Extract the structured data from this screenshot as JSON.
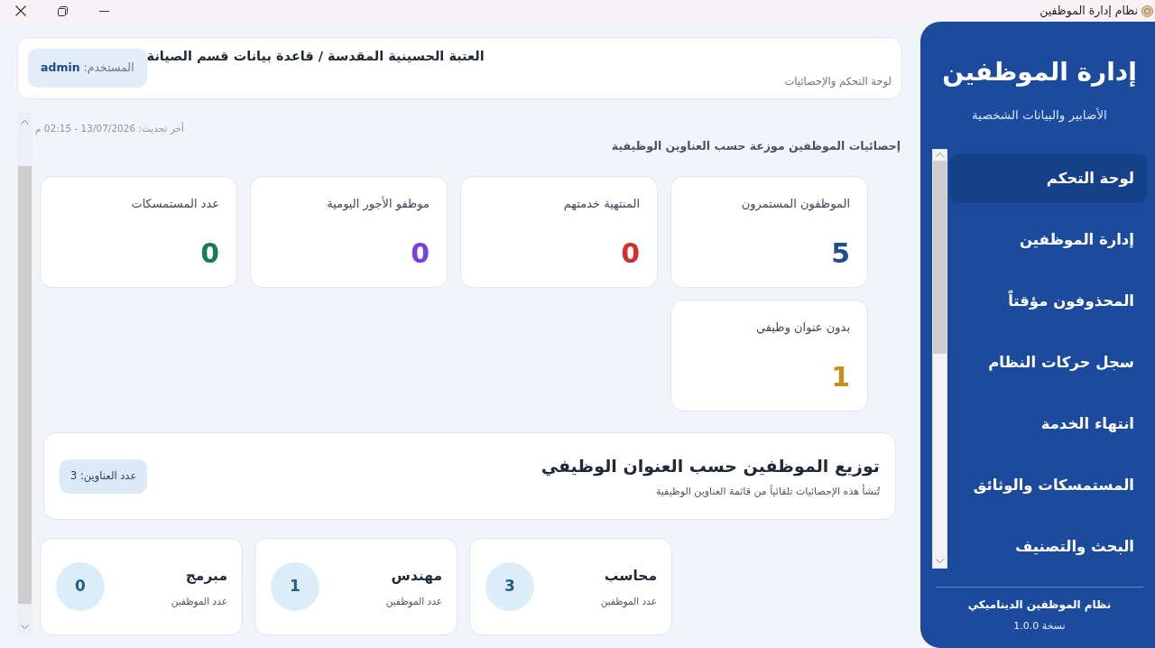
{
  "window": {
    "title": "نظام إدارة الموظفين"
  },
  "header": {
    "title": "العتبة الحسينية المقدسة / قاعدة بيانات قسم الصيانة",
    "subtitle": "لوحة التحكم والإحصائيات",
    "user": "المستخدم: **admin**"
  },
  "last_update": "أخر تحديث: 13/07/2026 - 02:15 م",
  "stats_heading": "إحصائيات الموظفين موزعة حسب العناوين الوظيفية",
  "stats": [
    {
      "label": "الموظفون المستمرون",
      "value": "5",
      "color": "#1f4e8c"
    },
    {
      "label": "المنتهية خدمتهم",
      "value": "0",
      "color": "#d32f2f"
    },
    {
      "label": "موظفو الأجور اليومية",
      "value": "0",
      "color": "#7b3fe4"
    },
    {
      "label": "عدد المستمسكات",
      "value": "0",
      "color": "#1b7a5e"
    },
    {
      "label": "بدون عنوان وظيفي",
      "value": "1",
      "color": "#c8901a"
    }
  ],
  "distribution": {
    "title": "توزيع الموظفين حسب العنوان الوظيفي",
    "subtitle": "تُنشأ هذه الإحصائيات تلقائياً من قائمة العناوين الوظيفية",
    "badge": "عدد العناوين: 3",
    "titles": [
      {
        "name": "محاسب",
        "caption": "عدد الموظفين",
        "count": "3"
      },
      {
        "name": "مهندس",
        "caption": "عدد الموظفين",
        "count": "1"
      },
      {
        "name": "مبرمج",
        "caption": "عدد الموظفين",
        "count": "0"
      }
    ]
  },
  "sidebar": {
    "title": "إدارة الموظفين",
    "subtitle": "الأضابير والبيانات الشخصية",
    "items": [
      {
        "label": "لوحة التحكم",
        "selected": true
      },
      {
        "label": "إدارة الموظفين",
        "selected": false
      },
      {
        "label": "المحذوفون مؤقتاً",
        "selected": false
      },
      {
        "label": "سجل حركات النظام",
        "selected": false
      },
      {
        "label": "انتهاء الخدمة",
        "selected": false
      },
      {
        "label": "المستمسكات والوثائق",
        "selected": false
      },
      {
        "label": "البحث والتصنيف",
        "selected": false
      }
    ],
    "footer_name": "نظام الموظفين الديناميكي",
    "version": "نسخة 1.0.0"
  }
}
